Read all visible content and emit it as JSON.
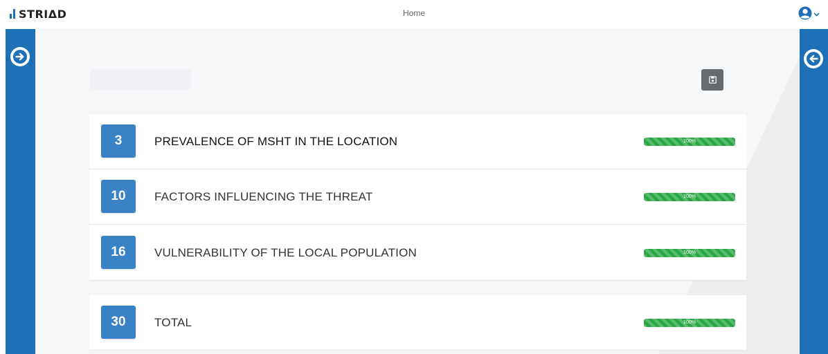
{
  "app": {
    "logo_text": "STRIΔD",
    "nav_home": "Home",
    "user_icon": "user-circle-icon",
    "user_caret": "caret-down-icon"
  },
  "sidebar_left": {
    "icon": "arrow-circle-right-icon"
  },
  "sidebar_right": {
    "icon": "arrow-circle-left-icon"
  },
  "toolbar": {
    "save_icon": "save-icon"
  },
  "indicators": [
    {
      "score": "3",
      "label": "PREVALENCE OF MSHT IN THE LOCATION",
      "progress": 100,
      "progress_label": "100%"
    },
    {
      "score": "10",
      "label": "FACTORS INFLUENCING THE THREAT",
      "progress": 100,
      "progress_label": "100%"
    },
    {
      "score": "16",
      "label": "VULNERABILITY OF THE LOCAL POPULATION",
      "progress": 100,
      "progress_label": "100%"
    }
  ],
  "total": {
    "score": "30",
    "label": "TOTAL",
    "progress": 100,
    "progress_label": "100%"
  },
  "colors": {
    "brand_blue": "#1d6fb6",
    "badge_blue": "#3a82c6",
    "progress_green": "#28a745",
    "save_button": "#666b70"
  }
}
